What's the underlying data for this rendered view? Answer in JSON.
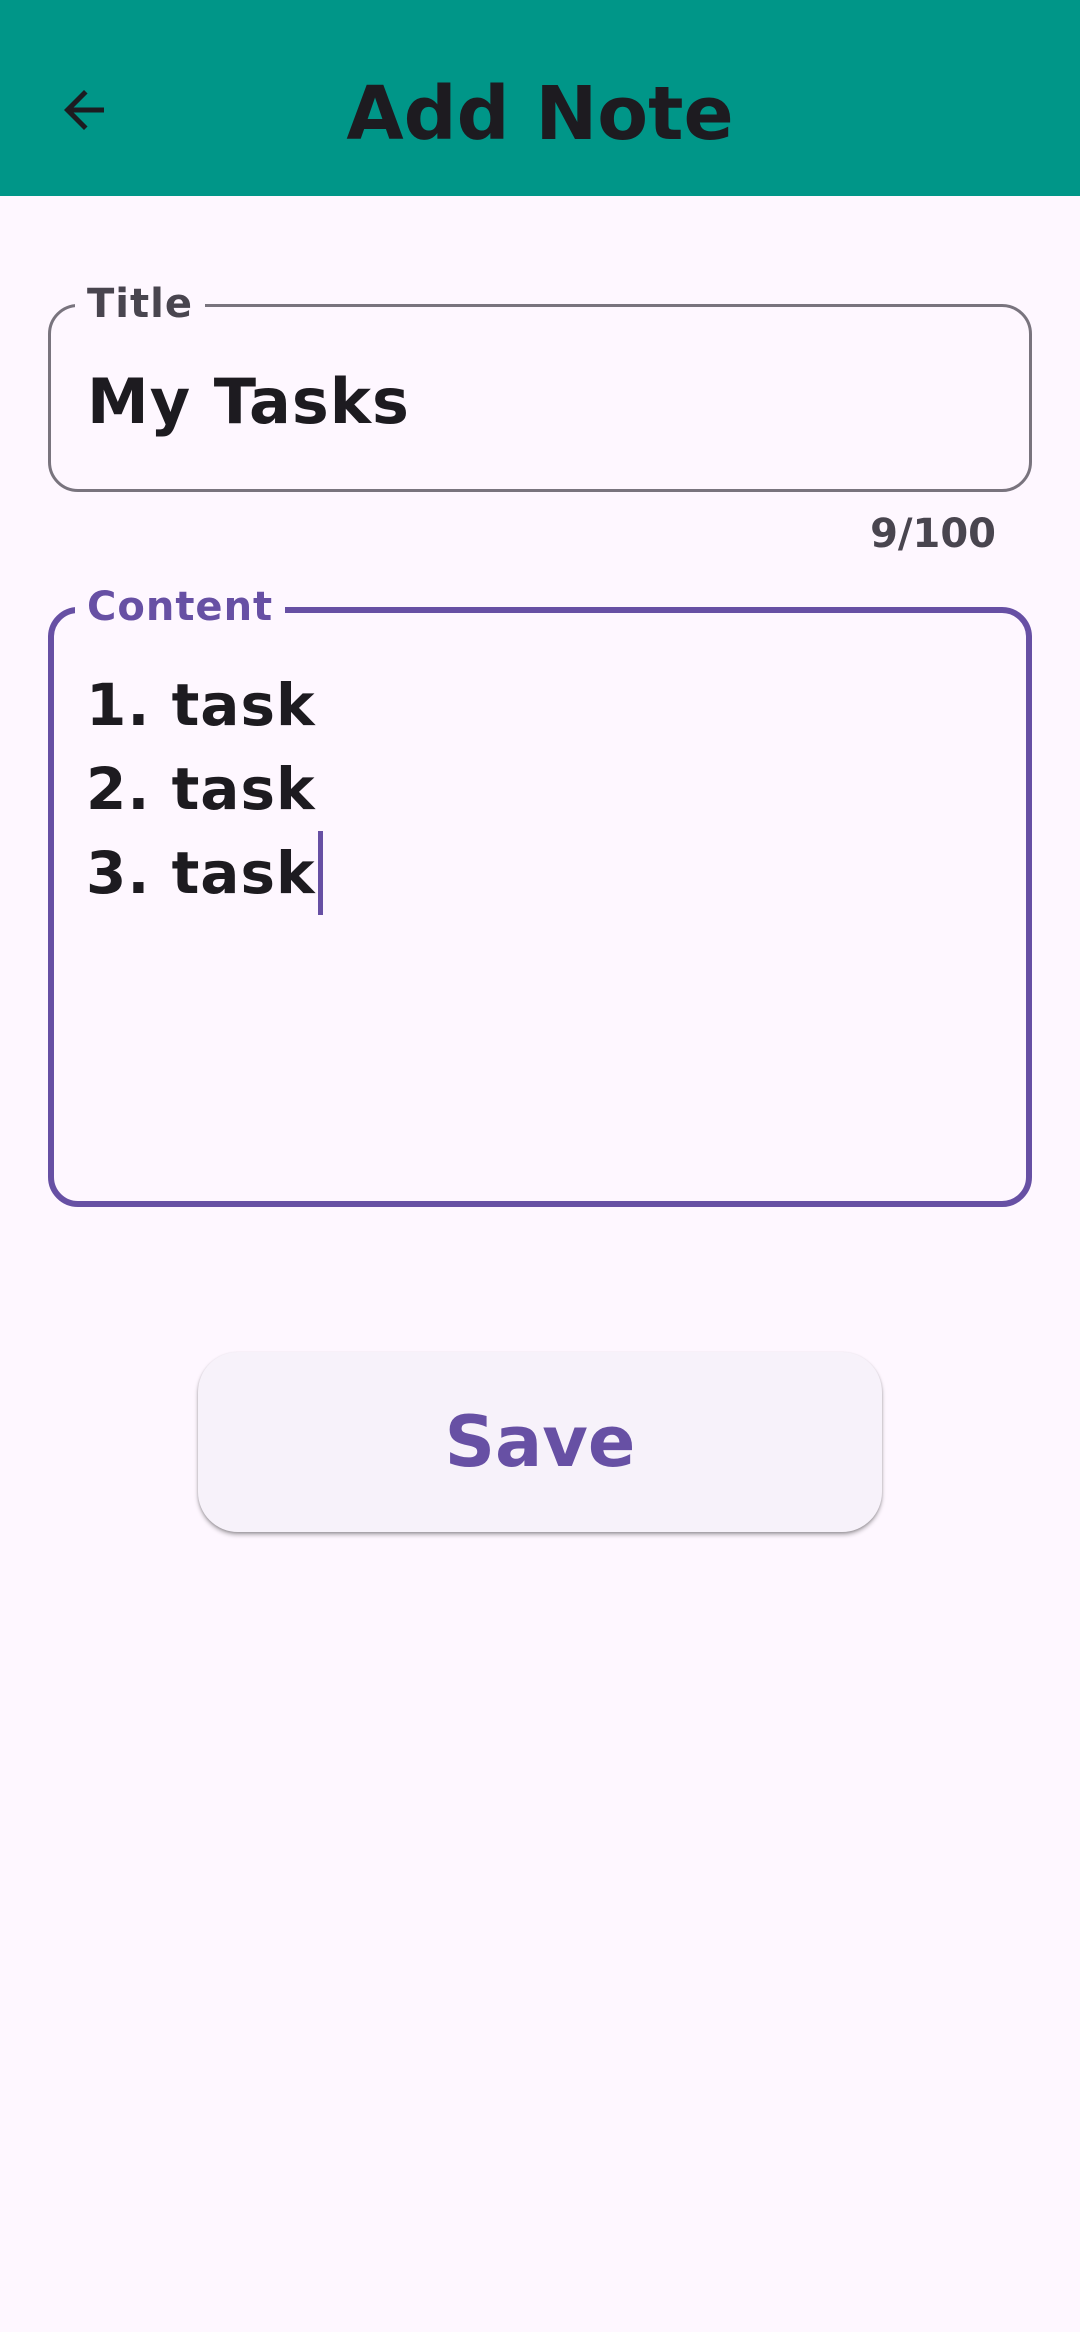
{
  "app_bar": {
    "title": "Add Note",
    "back_icon": "arrow-left-icon",
    "background_color": "#009688"
  },
  "title_field": {
    "label": "Title",
    "value": "My Tasks",
    "counter": "9/100"
  },
  "content_field": {
    "label": "Content",
    "lines": [
      "1. task",
      "2. task",
      "3. task"
    ],
    "accent_color": "#6750a4",
    "focused": true
  },
  "save_button": {
    "label": "Save"
  }
}
